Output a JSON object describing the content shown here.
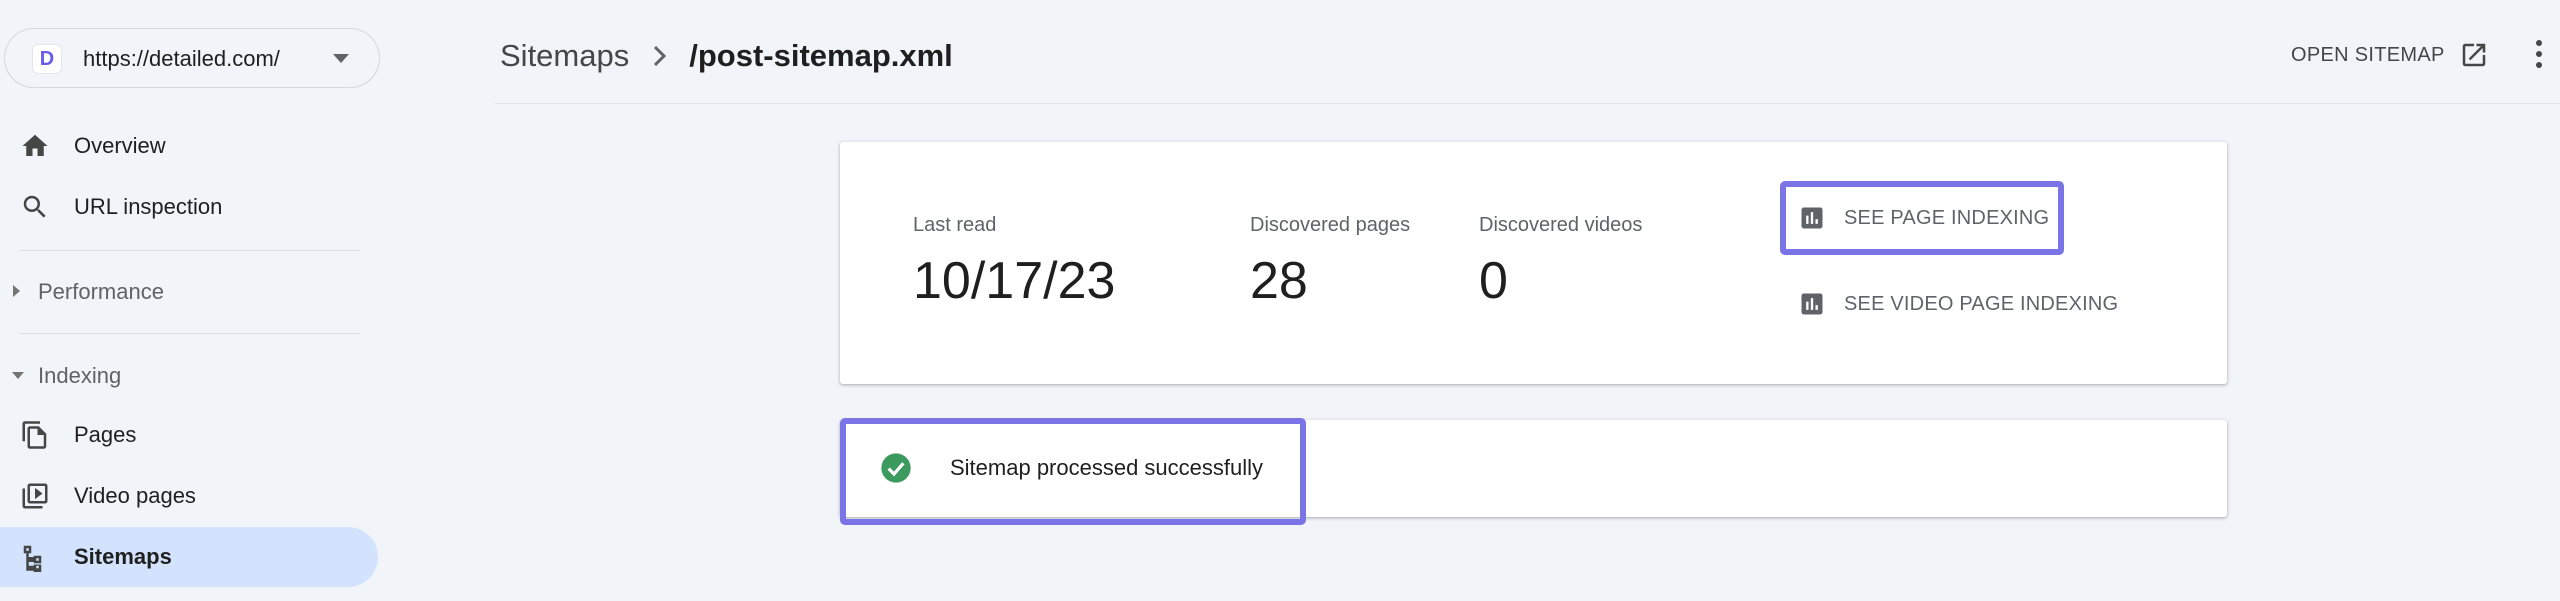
{
  "property": {
    "url": "https://detailed.com/",
    "favicon_letter": "D",
    "favicon_color": "#6b5ce7"
  },
  "sidebar": {
    "items": [
      {
        "label": "Overview",
        "icon": "home-icon"
      },
      {
        "label": "URL inspection",
        "icon": "search-icon"
      }
    ],
    "sections": [
      {
        "label": "Performance",
        "expanded": false
      },
      {
        "label": "Indexing",
        "expanded": true
      }
    ],
    "indexing_items": [
      {
        "label": "Pages",
        "icon": "pages-icon"
      },
      {
        "label": "Video pages",
        "icon": "video-pages-icon"
      },
      {
        "label": "Sitemaps",
        "icon": "sitemap-icon",
        "active": true
      }
    ]
  },
  "header": {
    "breadcrumb_root": "Sitemaps",
    "breadcrumb_current": "/post-sitemap.xml",
    "open_sitemap_label": "OPEN SITEMAP"
  },
  "stats": {
    "last_read_label": "Last read",
    "last_read_value": "10/17/23",
    "discovered_pages_label": "Discovered pages",
    "discovered_pages_value": "28",
    "discovered_videos_label": "Discovered videos",
    "discovered_videos_value": "0"
  },
  "actions": {
    "see_page_indexing": "SEE PAGE INDEXING",
    "see_video_page_indexing": "SEE VIDEO PAGE INDEXING"
  },
  "status": {
    "message": "Sitemap processed successfully",
    "color": "#3c9a5f"
  },
  "colors": {
    "highlight": "#7b74e6",
    "active_nav_bg": "#d3e3fd",
    "page_bg": "#f1f4f9"
  }
}
